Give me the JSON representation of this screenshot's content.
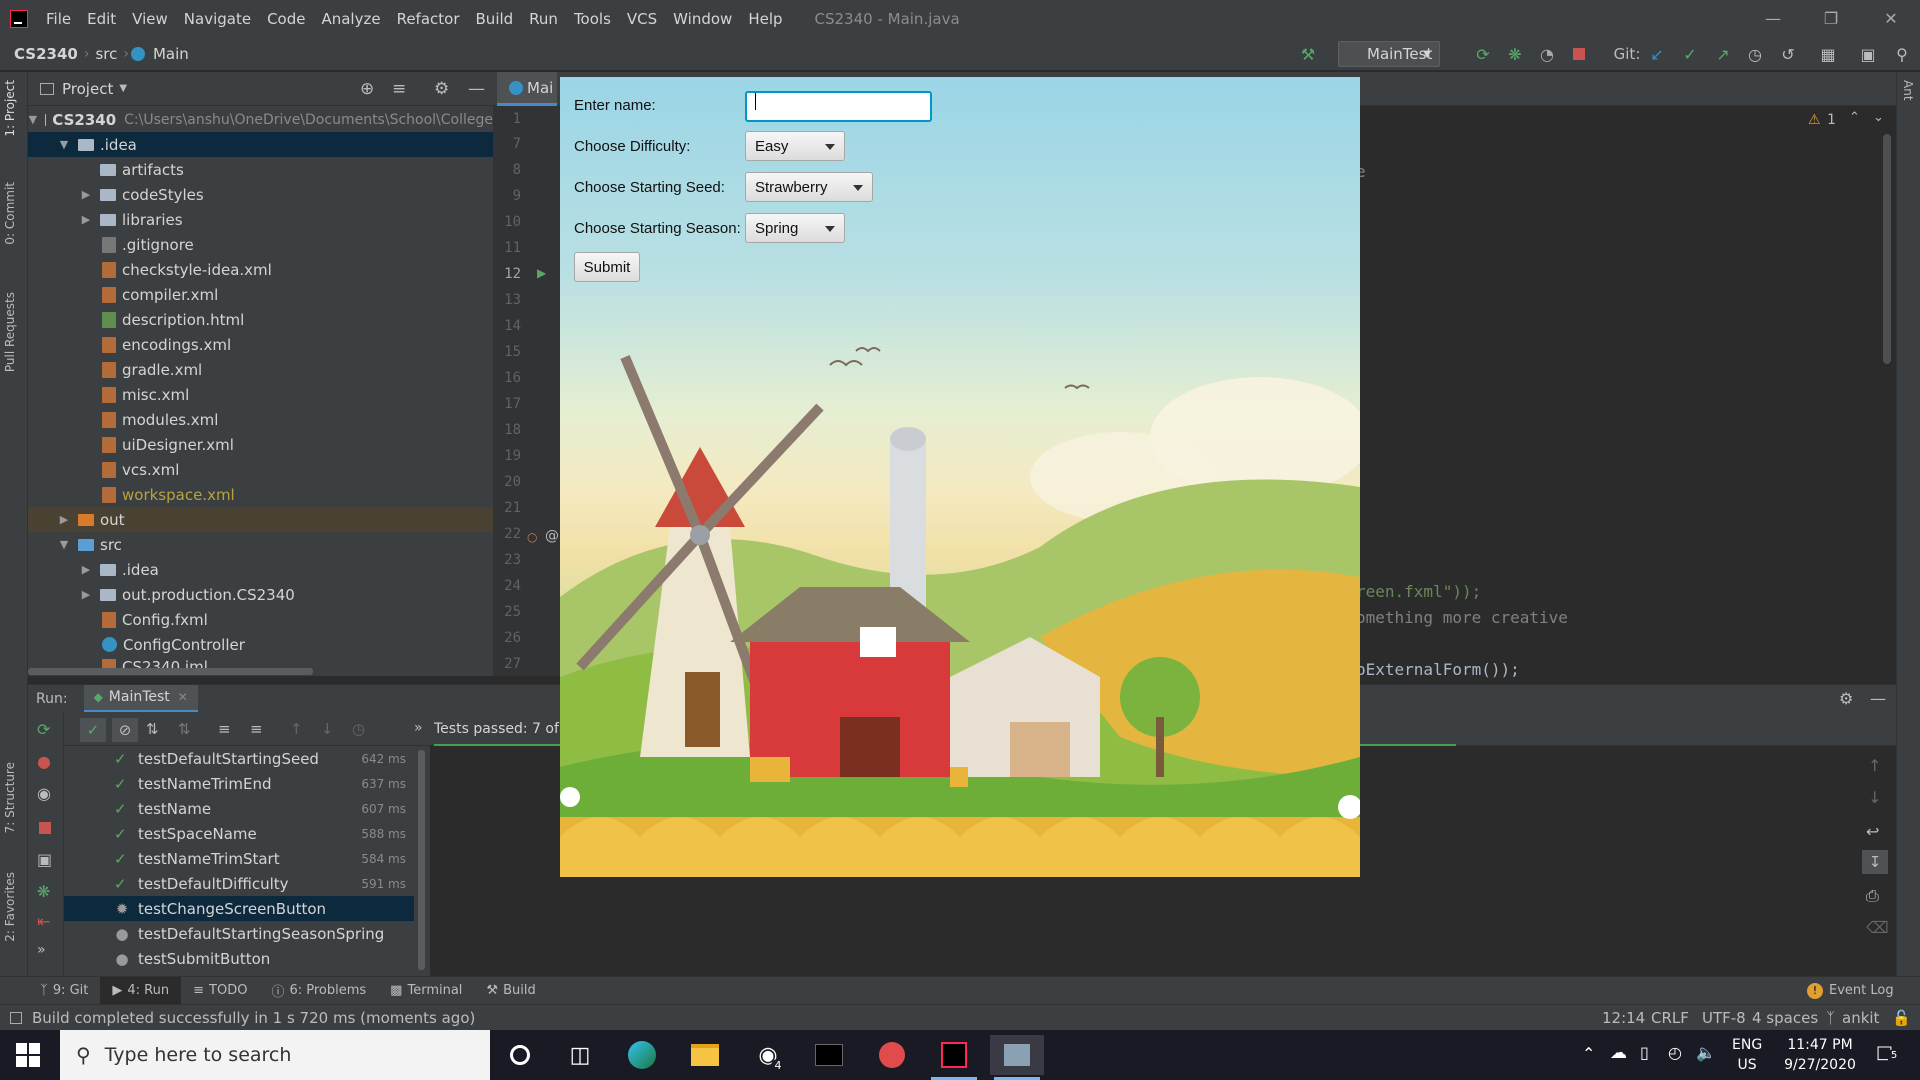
{
  "window": {
    "title": "CS2340 - Main.java",
    "menus": [
      "File",
      "Edit",
      "View",
      "Navigate",
      "Code",
      "Analyze",
      "Refactor",
      "Build",
      "Run",
      "Tools",
      "VCS",
      "Window",
      "Help"
    ]
  },
  "breadcrumb": {
    "project": "CS2340",
    "folder": "src",
    "file": "Main"
  },
  "toolbar": {
    "run_config": "MainTest",
    "git_label": "Git:"
  },
  "left_tabs": [
    "1: Project",
    "0: Commit",
    "Pull Requests",
    "7: Structure",
    "2: Favorites"
  ],
  "right_tabs": [
    "Ant"
  ],
  "project_panel": {
    "title": "Project",
    "root_name": "CS2340",
    "root_path": "C:\\Users\\anshu\\OneDrive\\Documents\\School\\College",
    "items": [
      {
        "label": ".idea",
        "type": "folder",
        "level": 1,
        "expanded": true,
        "selected": true
      },
      {
        "label": "artifacts",
        "type": "folder",
        "level": 2
      },
      {
        "label": "codeStyles",
        "type": "folder",
        "level": 2,
        "collapsed": true
      },
      {
        "label": "libraries",
        "type": "folder",
        "level": 2,
        "collapsed": true
      },
      {
        "label": ".gitignore",
        "type": "git",
        "level": 2
      },
      {
        "label": "checkstyle-idea.xml",
        "type": "xml",
        "level": 2
      },
      {
        "label": "compiler.xml",
        "type": "xml",
        "level": 2
      },
      {
        "label": "description.html",
        "type": "html",
        "level": 2
      },
      {
        "label": "encodings.xml",
        "type": "xml",
        "level": 2
      },
      {
        "label": "gradle.xml",
        "type": "xml",
        "level": 2
      },
      {
        "label": "misc.xml",
        "type": "xml",
        "level": 2
      },
      {
        "label": "modules.xml",
        "type": "xml",
        "level": 2
      },
      {
        "label": "uiDesigner.xml",
        "type": "xml",
        "level": 2
      },
      {
        "label": "vcs.xml",
        "type": "xml",
        "level": 2
      },
      {
        "label": "workspace.xml",
        "type": "xml-modified",
        "level": 2
      },
      {
        "label": "out",
        "type": "folder-orange",
        "level": 1,
        "collapsed": true
      },
      {
        "label": "src",
        "type": "folder-blue",
        "level": 1,
        "expanded": true
      },
      {
        "label": ".idea",
        "type": "folder",
        "level": 2,
        "collapsed": true
      },
      {
        "label": "out.production.CS2340",
        "type": "folder",
        "level": 2,
        "collapsed": true
      },
      {
        "label": "Config.fxml",
        "type": "xml",
        "level": 2
      },
      {
        "label": "ConfigController",
        "type": "class",
        "level": 2
      },
      {
        "label": "CS2340.iml",
        "type": "xml",
        "level": 2
      }
    ]
  },
  "editor": {
    "tab_label": "Mai",
    "line_numbers": [
      "1",
      "7",
      "8",
      "9",
      "10",
      "11",
      "12",
      "13",
      "14",
      "15",
      "16",
      "17",
      "18",
      "19",
      "20",
      "21",
      "22",
      "23",
      "24",
      "25",
      "26",
      "27"
    ],
    "visible_code": [
      {
        "line": "24",
        "text": "reen.fxml\"));"
      },
      {
        "line": "25",
        "text": "omething more creative"
      },
      {
        "line": "27",
        "text": "oExternalForm());"
      }
    ],
    "partial_char": "e",
    "warnings": "1",
    "gutter_marker_22": "@"
  },
  "run_panel": {
    "label": "Run:",
    "config_tab": "MainTest",
    "status": "Tests passed: 7 of",
    "tests": [
      {
        "name": "testDefaultStartingSeed",
        "time": "642 ms",
        "state": "passed"
      },
      {
        "name": "testNameTrimEnd",
        "time": "637 ms",
        "state": "passed"
      },
      {
        "name": "testName",
        "time": "607 ms",
        "state": "passed"
      },
      {
        "name": "testSpaceName",
        "time": "588 ms",
        "state": "passed"
      },
      {
        "name": "testNameTrimStart",
        "time": "584 ms",
        "state": "passed"
      },
      {
        "name": "testDefaultDifficulty",
        "time": "591 ms",
        "state": "passed"
      },
      {
        "name": "testChangeScreenButton",
        "time": "",
        "state": "running"
      },
      {
        "name": "testDefaultStartingSeasonSpring",
        "time": "",
        "state": "pending"
      },
      {
        "name": "testSubmitButton",
        "time": "",
        "state": "pending"
      }
    ]
  },
  "bottom_tabs": [
    "9: Git",
    "4: Run",
    "TODO",
    "6: Problems",
    "Terminal",
    "Build"
  ],
  "event_log": "Event Log",
  "status_bar": {
    "message": "Build completed successfully in 1 s 720 ms (moments ago)",
    "position": "12:14",
    "line_sep": "CRLF",
    "encoding": "UTF-8",
    "indent": "4 spaces",
    "branch": "ankit"
  },
  "fx_dialog": {
    "name_label": "Enter name:",
    "name_value": "",
    "difficulty_label": "Choose Difficulty:",
    "difficulty_value": "Easy",
    "seed_label": "Choose Starting Seed:",
    "seed_value": "Strawberry",
    "season_label": "Choose Starting Season:",
    "season_value": "Spring",
    "submit_label": "Submit"
  },
  "taskbar": {
    "search_placeholder": "Type here to search",
    "lang": "ENG",
    "region": "US",
    "time": "11:47 PM",
    "date": "9/27/2020",
    "notification_count": "5",
    "badge_count": "4"
  }
}
